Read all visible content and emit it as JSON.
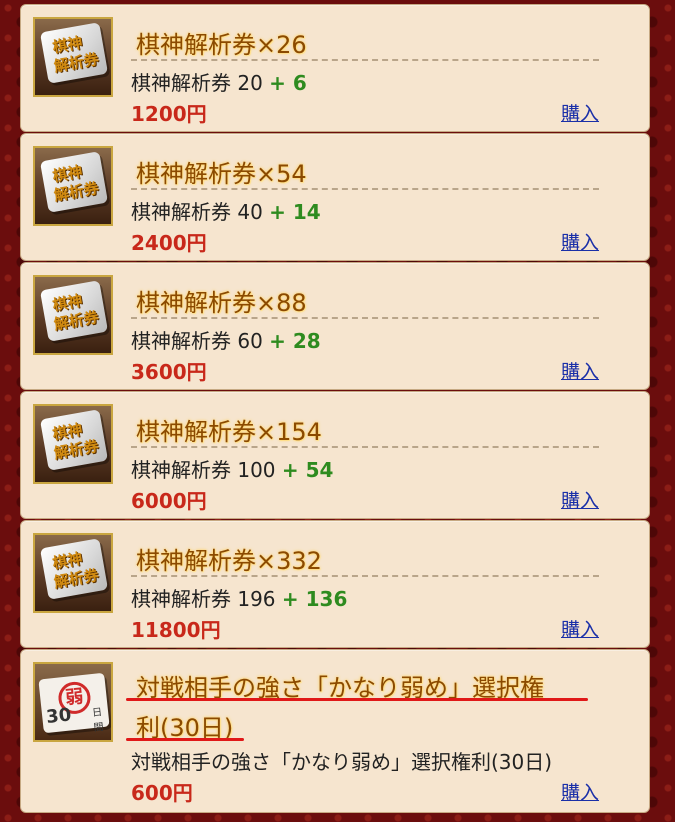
{
  "items": [
    {
      "title": "棋神解析券×26",
      "desc": "棋神解析券 20",
      "bonus": "+ 6",
      "price": "1200円",
      "buy": "購入"
    },
    {
      "title": "棋神解析券×54",
      "desc": "棋神解析券 40",
      "bonus": "+ 14",
      "price": "2400円",
      "buy": "購入"
    },
    {
      "title": "棋神解析券×88",
      "desc": "棋神解析券 60",
      "bonus": "+ 28",
      "price": "3600円",
      "buy": "購入"
    },
    {
      "title": "棋神解析券×154",
      "desc": "棋神解析券 100",
      "bonus": "+ 54",
      "price": "6000円",
      "buy": "購入"
    },
    {
      "title": "棋神解析券×332",
      "desc": "棋神解析券 196",
      "bonus": "+ 136",
      "price": "11800円",
      "buy": "購入"
    }
  ],
  "special": {
    "title_line1": "対戦相手の強さ「かなり弱め」選択権",
    "title_line2": "利(30日)",
    "desc": "対戦相手の強さ「かなり弱め」選択権利(30日)",
    "price": "600円",
    "buy": "購入"
  },
  "icon_text": {
    "ticket_line1": "棋神",
    "ticket_line2": "解析券",
    "stamp_char": "弱",
    "stamp_number": "30",
    "stamp_unit": "日間"
  },
  "colors": {
    "bonus": "#2e8b1f",
    "price": "#c8281a",
    "link": "#1a2fa8",
    "highlight_underline": "#e01818"
  }
}
